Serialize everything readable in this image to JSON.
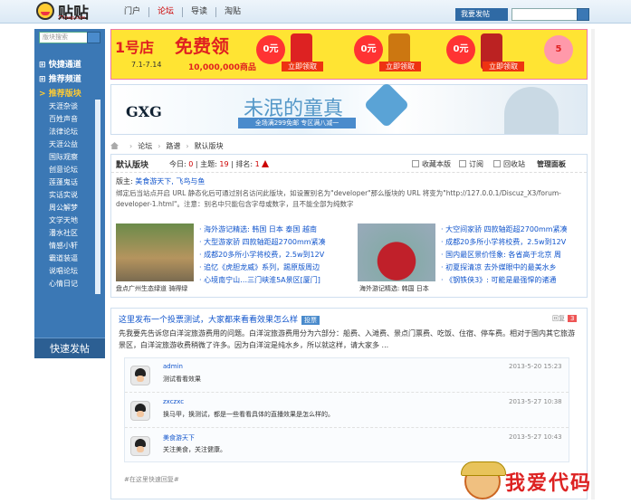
{
  "header": {
    "logo_text": "贴贴",
    "logo_sub": "TT.mop.com",
    "nav": [
      "门户",
      "论坛",
      "导读",
      "淘贴"
    ],
    "active_nav": "论坛",
    "fav_button": "我要发帖"
  },
  "sidebar": {
    "search_placeholder": "版块搜索",
    "sections": [
      "快捷通道",
      "推荐频道",
      "推荐版块"
    ],
    "items": [
      "天涯杂谈",
      "百姓声音",
      "法律论坛",
      "天涯公益",
      "国际观察",
      "创意论坛",
      "莲蓬鬼话",
      "实话实说",
      "周公解梦",
      "文学天地",
      "潘水社区",
      "情感小轩",
      "霸道装逼",
      "说唱论坛",
      "心情日记"
    ],
    "quick_post": "快速发帖"
  },
  "banner1": {
    "brand": "1号店",
    "headline": "免费领",
    "date": "7.1-7.14",
    "count": "10,000,000商品",
    "coupons": [
      "0元",
      "0元",
      "0元"
    ],
    "grab_labels": [
      "立即领取",
      "立即领取",
      "立即领取"
    ]
  },
  "banner2": {
    "brand": "GXG",
    "title": "未泯的童真",
    "subtitle": "全场满299免邮 专区满八减一"
  },
  "breadcrumb": [
    "论坛",
    "路谱",
    "默认版块"
  ],
  "board": {
    "name": "默认版块",
    "today_label": "今日:",
    "today": "0",
    "topics_label": "主题:",
    "topics": "19",
    "rank_label": "排名:",
    "rank": "1",
    "actions": [
      "收藏本版",
      "订阅",
      "回收站",
      "管理面板"
    ],
    "moderator_label": "版主:",
    "moderators": "美食游天下, 飞鸟与鱼",
    "description": "绑定后当站点开启 URL 静态化后可通过别名访问此版块，如设置别名为\"developer\"那么版块的 URL 将变为\"http://127.0.0.1/Discuz_X3/forum-developer-1.html\"。注意：别名中只能包含字母或数字，且不能全部为纯数字",
    "photo1_caption": "盘点广州生态绿道 骑得绿",
    "photo2_caption": "海外游记精选: 韩国 日本",
    "links_left": [
      "海外游记精选: 韩国 日本 泰国 越南",
      "大型游家骄 四款轴距超2700mm紧凑",
      "成都20多所小学将校费，2.5w到12V",
      "追忆《虎胆龙威》系列，踢原版周边",
      "心境南宁山…三门峡淮5A景区[厦门]"
    ],
    "links_right": [
      "大空间家骄 四款轴距超2700mm紧凑",
      "成都20多所小学将校费，2.5w到12V",
      "国内最区景价怪象: 各省高于北京 周",
      "初夏探清凉 去外媒眼中的最美水乡",
      "《钢铁侠3》: 可能是最强悍的诸通"
    ]
  },
  "post": {
    "title": "这里发布一个投票测试，大家都来看看效果怎么样",
    "badge": "投票",
    "reply_label": "回复",
    "reply_count": "3",
    "body": "先我要先告诉您白洋淀旅游费用的问题。白洋淀旅游费用分为六部分：船费、入滩费、景点门票费、吃饭、住宿、停车费。相对于国内其它旅游景区，白洋淀旅游收费稍微了许多。因为白洋淀是纯水乡，所以就这样，请大家多 ...",
    "comments": [
      {
        "user": "admin",
        "text": "测试看看效果",
        "time": "2013-5-20 15:23"
      },
      {
        "user": "zxczxc",
        "text": "换马甲，换测试，都是一些看看具体的直播效果是怎么样的。",
        "time": "2013-5-27 10:38"
      },
      {
        "user": "美食游天下",
        "text": "关注美食，关注健康。",
        "time": "2013-5-27 10:43"
      }
    ],
    "quick_reply": "#在这里快速回复#"
  },
  "watermark": "我爱代码"
}
